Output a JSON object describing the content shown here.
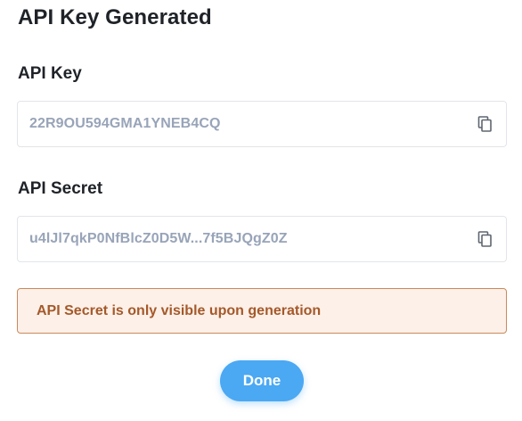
{
  "dialog": {
    "title": "API Key Generated"
  },
  "api_key": {
    "label": "API Key",
    "value": "22R9OU594GMA1YNEB4CQ",
    "copy_icon": "copy-icon"
  },
  "api_secret": {
    "label": "API Secret",
    "value": "u4lJl7qkP0NfBlcZ0D5W...7f5BJQgZ0Z",
    "copy_icon": "copy-icon"
  },
  "alert": {
    "message": "API Secret is only visible upon generation"
  },
  "actions": {
    "done_label": "Done"
  },
  "colors": {
    "accent": "#4ba8f3",
    "value_text": "#98a4b8",
    "alert_bg": "#fdf0e8",
    "alert_border": "#c98a5c",
    "alert_text": "#a4592a"
  }
}
